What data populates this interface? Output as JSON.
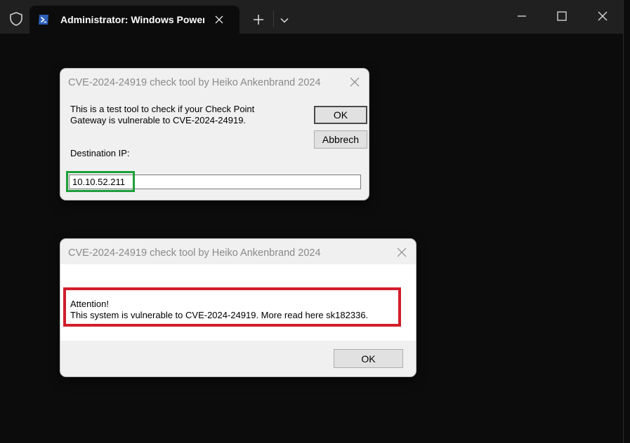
{
  "terminal": {
    "tab_title": "Administrator: Windows PowerShell",
    "icons": {
      "shield": "shield-icon",
      "powershell": "powershell-icon",
      "close_tab": "close-icon",
      "new_tab": "plus-icon",
      "dropdown": "chevron-down-icon",
      "minimize": "minimize-icon",
      "maximize": "maximize-icon",
      "close_window": "close-icon"
    }
  },
  "dialog_input": {
    "title": "CVE-2024-24919 check tool by Heiko Ankenbrand 2024",
    "message_line1": "This is a test tool to check if your Check Point",
    "message_line2": "Gateway is vulnerable to CVE-2024-24919.",
    "label": "Destination IP:",
    "ip_value": "10.10.52.211",
    "ok_label": "OK",
    "cancel_label": "Abbrech"
  },
  "dialog_result": {
    "title": "CVE-2024-24919 check tool by Heiko Ankenbrand 2024",
    "line1": "Attention!",
    "line2": "This system is vulnerable to CVE-2024-24919. More read here sk182336.",
    "ok_label": "OK"
  },
  "colors": {
    "terminal_bg": "#0c0c0c",
    "titlebar_bg": "#202020",
    "highlight_green": "#1e9f3a",
    "highlight_red": "#d21e2b"
  }
}
